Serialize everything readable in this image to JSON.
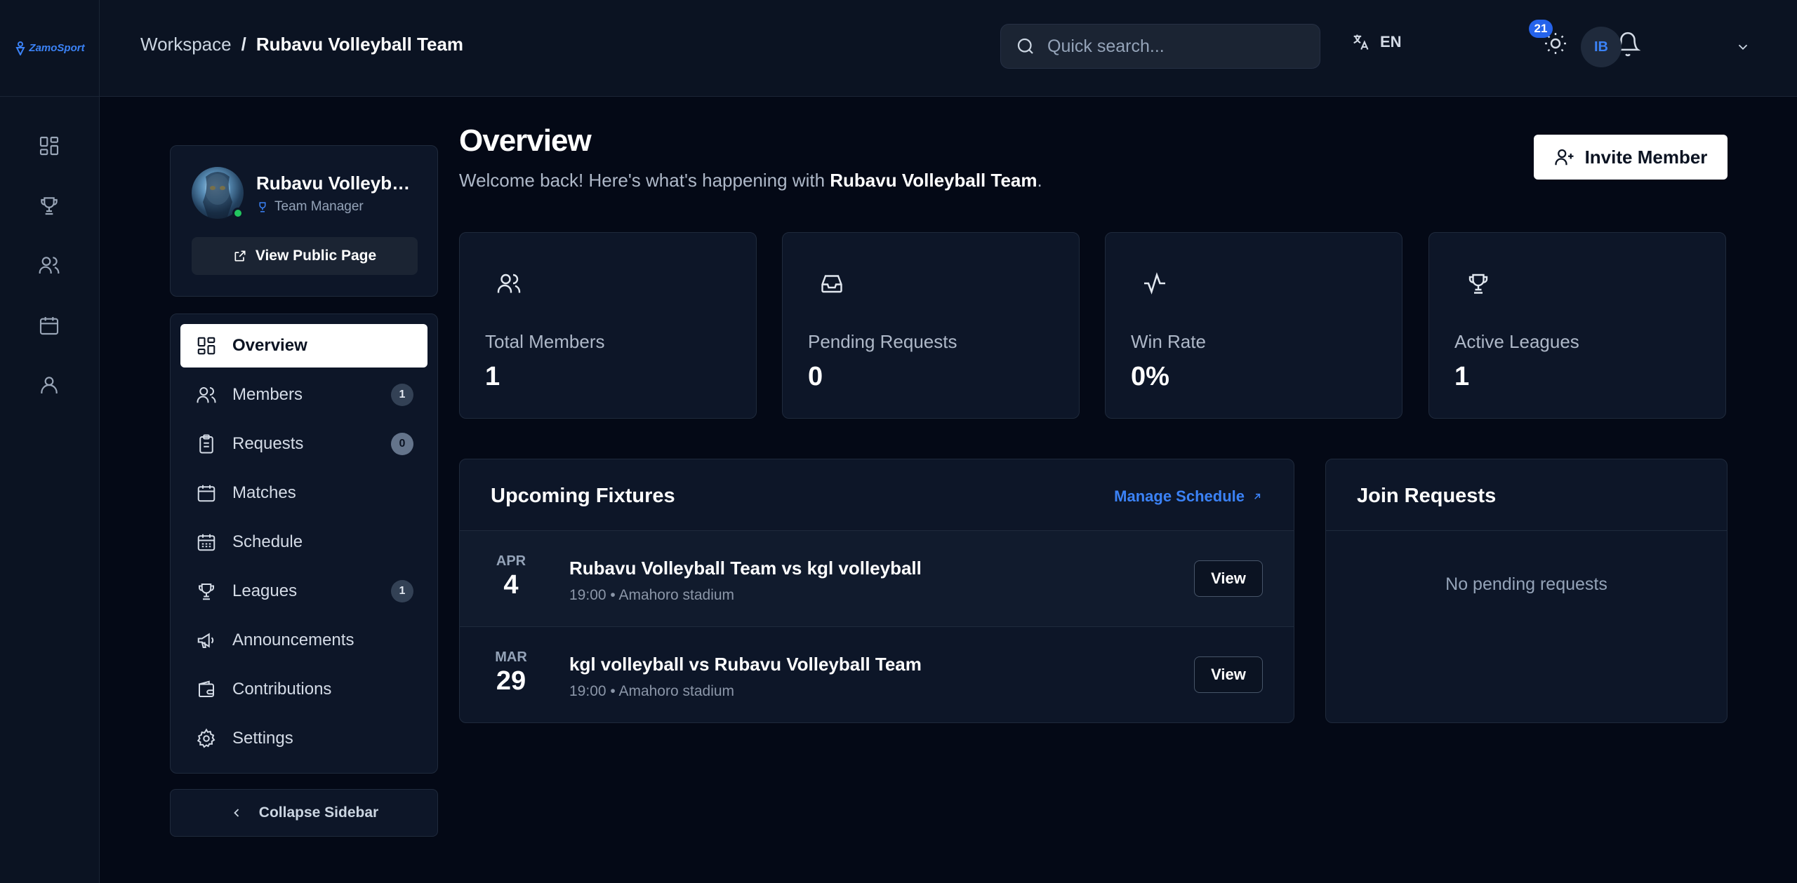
{
  "app": {
    "logo_text": "ZamoSport"
  },
  "breadcrumb": {
    "root": "Workspace",
    "separator": "/",
    "current": "Rubavu Volleyball Team"
  },
  "header": {
    "search_placeholder": "Quick search...",
    "language": "EN",
    "notification_count": "21",
    "user_initials": "IB"
  },
  "profile": {
    "team_name": "Rubavu Volleyball Team",
    "role": "Team Manager",
    "public_page_label": "View Public Page"
  },
  "nav": {
    "items": [
      {
        "label": "Overview",
        "icon": "dashboard-icon",
        "count": null
      },
      {
        "label": "Members",
        "icon": "users-icon",
        "count": "1"
      },
      {
        "label": "Requests",
        "icon": "clipboard-icon",
        "count": "0"
      },
      {
        "label": "Matches",
        "icon": "calendar-icon",
        "count": null
      },
      {
        "label": "Schedule",
        "icon": "calendar-grid-icon",
        "count": null
      },
      {
        "label": "Leagues",
        "icon": "trophy-icon",
        "count": "1"
      },
      {
        "label": "Announcements",
        "icon": "megaphone-icon",
        "count": null
      },
      {
        "label": "Contributions",
        "icon": "wallet-icon",
        "count": null
      },
      {
        "label": "Settings",
        "icon": "gear-icon",
        "count": null
      }
    ],
    "collapse_label": "Collapse Sidebar"
  },
  "page": {
    "title": "Overview",
    "subtitle_prefix": "Welcome back! Here's what's happening with ",
    "subtitle_team": "Rubavu Volleyball Team",
    "subtitle_suffix": ".",
    "invite_label": "Invite Member"
  },
  "stats": [
    {
      "label": "Total Members",
      "value": "1",
      "icon": "users-icon"
    },
    {
      "label": "Pending Requests",
      "value": "0",
      "icon": "inbox-icon"
    },
    {
      "label": "Win Rate",
      "value": "0%",
      "icon": "activity-icon"
    },
    {
      "label": "Active Leagues",
      "value": "1",
      "icon": "trophy-icon"
    }
  ],
  "fixtures": {
    "title": "Upcoming Fixtures",
    "manage_label": "Manage Schedule",
    "rows": [
      {
        "month": "APR",
        "day": "4",
        "title": "Rubavu Volleyball Team vs kgl volleyball",
        "time": "19:00",
        "venue": "Amahoro stadium",
        "action": "View"
      },
      {
        "month": "MAR",
        "day": "29",
        "title": "kgl volleyball vs Rubavu Volleyball Team",
        "time": "19:00",
        "venue": "Amahoro stadium",
        "action": "View"
      }
    ],
    "meta_separator": "•"
  },
  "join_requests": {
    "title": "Join Requests",
    "empty_text": "No pending requests"
  },
  "colors": {
    "background": "#040916",
    "panel": "#0d1628",
    "accent": "#3b82f6",
    "online": "#22c55e"
  }
}
